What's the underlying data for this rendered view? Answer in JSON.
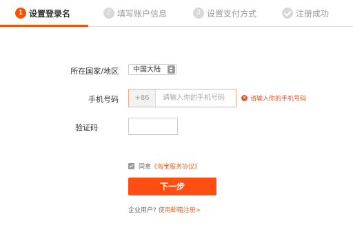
{
  "steps": [
    {
      "number": "1",
      "label": "设置登录名"
    },
    {
      "number": "2",
      "label": "填写账户信息"
    },
    {
      "number": "3",
      "label": "设置支付方式"
    },
    {
      "number": "",
      "label": "注册成功"
    }
  ],
  "form": {
    "country_label": "所在国家/地区",
    "country_value": "中国大陆",
    "phone_label": "手机号码",
    "phone_prefix": "+86",
    "phone_placeholder": "请输入你的手机号码",
    "phone_error": "请输入你的手机号码",
    "code_label": "验证码",
    "agree_text": "同意",
    "agree_link": "《淘宝服务协议》",
    "next_button": "下一步",
    "enterprise_question": "企业用户?",
    "enterprise_link": "使用邮箱注册>"
  },
  "colors": {
    "accent": "#ff5000",
    "button": "#ff4e12",
    "error": "#e2552b"
  }
}
